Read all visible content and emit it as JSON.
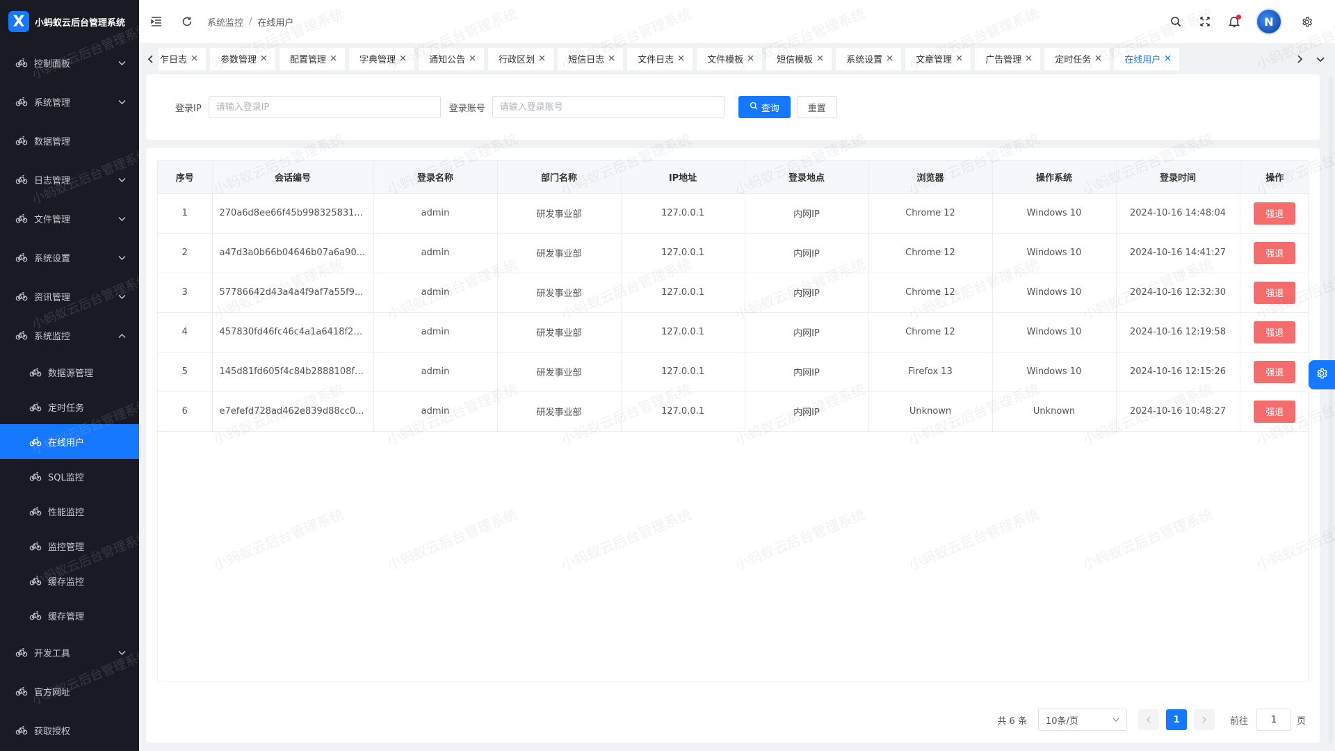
{
  "app": {
    "title": "小蚂蚁云后台管理系统",
    "logo_glyph": "X"
  },
  "sidebar": {
    "items": [
      {
        "label": "控制面板",
        "icon": "bicycle-icon",
        "expandable": true,
        "expanded": false
      },
      {
        "label": "系统管理",
        "icon": "bicycle-icon",
        "expandable": true,
        "expanded": false
      },
      {
        "label": "数据管理",
        "icon": "bicycle-icon",
        "expandable": false
      },
      {
        "label": "日志管理",
        "icon": "bicycle-icon",
        "expandable": true,
        "expanded": false
      },
      {
        "label": "文件管理",
        "icon": "bicycle-icon",
        "expandable": true,
        "expanded": false
      },
      {
        "label": "系统设置",
        "icon": "bicycle-icon",
        "expandable": true,
        "expanded": false
      },
      {
        "label": "资讯管理",
        "icon": "bicycle-icon",
        "expandable": true,
        "expanded": false
      },
      {
        "label": "系统监控",
        "icon": "bicycle-icon",
        "expandable": true,
        "expanded": true
      }
    ],
    "sub_items": [
      {
        "label": "数据源管理",
        "active": false
      },
      {
        "label": "定时任务",
        "active": false
      },
      {
        "label": "在线用户",
        "active": true
      },
      {
        "label": "SQL监控",
        "active": false
      },
      {
        "label": "性能监控",
        "active": false
      },
      {
        "label": "监控管理",
        "active": false
      },
      {
        "label": "缓存监控",
        "active": false
      },
      {
        "label": "缓存管理",
        "active": false
      }
    ],
    "bottom_items": [
      {
        "label": "开发工具",
        "icon": "bicycle-icon",
        "expandable": true
      },
      {
        "label": "官方网址",
        "icon": "bicycle-icon",
        "expandable": false
      },
      {
        "label": "获取授权",
        "icon": "bicycle-icon",
        "expandable": false
      }
    ]
  },
  "header": {
    "breadcrumb": [
      "系统监控",
      "在线用户"
    ],
    "separator": "/",
    "avatar_initial": "N"
  },
  "tabs": [
    {
      "label": "操作日志",
      "display": "乍日志",
      "active": false
    },
    {
      "label": "参数管理",
      "active": false
    },
    {
      "label": "配置管理",
      "active": false
    },
    {
      "label": "字典管理",
      "active": false
    },
    {
      "label": "通知公告",
      "active": false
    },
    {
      "label": "行政区划",
      "active": false
    },
    {
      "label": "短信日志",
      "active": false
    },
    {
      "label": "文件日志",
      "active": false
    },
    {
      "label": "文件模板",
      "active": false
    },
    {
      "label": "短信模板",
      "active": false
    },
    {
      "label": "系统设置",
      "active": false
    },
    {
      "label": "文章管理",
      "active": false
    },
    {
      "label": "广告管理",
      "active": false
    },
    {
      "label": "定时任务",
      "active": false
    },
    {
      "label": "在线用户",
      "active": true
    }
  ],
  "search": {
    "ip_label": "登录IP",
    "ip_placeholder": "请输入登录IP",
    "ip_value": "",
    "account_label": "登录账号",
    "account_placeholder": "请输入登录账号",
    "account_value": "",
    "query_label": "查询",
    "reset_label": "重置"
  },
  "table": {
    "columns": [
      "序号",
      "会话编号",
      "登录名称",
      "部门名称",
      "IP地址",
      "登录地点",
      "浏览器",
      "操作系统",
      "登录时间",
      "操作"
    ],
    "rows": [
      {
        "no": "1",
        "session": "270a6d8ee66f45b998325831...",
        "user": "admin",
        "dept": "研发事业部",
        "ip": "127.0.0.1",
        "location": "内网IP",
        "browser": "Chrome 12",
        "os": "Windows 10",
        "time": "2024-10-16 14:48:04",
        "action": "强退"
      },
      {
        "no": "2",
        "session": "a47d3a0b66b04646b07a6a90...",
        "user": "admin",
        "dept": "研发事业部",
        "ip": "127.0.0.1",
        "location": "内网IP",
        "browser": "Chrome 12",
        "os": "Windows 10",
        "time": "2024-10-16 14:41:27",
        "action": "强退"
      },
      {
        "no": "3",
        "session": "57786642d43a4a4f9af7a55f9...",
        "user": "admin",
        "dept": "研发事业部",
        "ip": "127.0.0.1",
        "location": "内网IP",
        "browser": "Chrome 12",
        "os": "Windows 10",
        "time": "2024-10-16 12:32:30",
        "action": "强退"
      },
      {
        "no": "4",
        "session": "457830fd46fc46c4a1a6418f2d...",
        "user": "admin",
        "dept": "研发事业部",
        "ip": "127.0.0.1",
        "location": "内网IP",
        "browser": "Chrome 12",
        "os": "Windows 10",
        "time": "2024-10-16 12:19:58",
        "action": "强退"
      },
      {
        "no": "5",
        "session": "145d81fd605f4c84b2888108fb...",
        "user": "admin",
        "dept": "研发事业部",
        "ip": "127.0.0.1",
        "location": "内网IP",
        "browser": "Firefox 13",
        "os": "Windows 10",
        "time": "2024-10-16 12:15:26",
        "action": "强退"
      },
      {
        "no": "6",
        "session": "e7efefd728ad462e839d88cc0...",
        "user": "admin",
        "dept": "研发事业部",
        "ip": "127.0.0.1",
        "location": "内网IP",
        "browser": "Unknown",
        "os": "Unknown",
        "time": "2024-10-16 10:48:27",
        "action": "强退"
      }
    ]
  },
  "pagination": {
    "total_text": "共 6 条",
    "page_size": "10条/页",
    "current_page": "1",
    "goto_label": "前往",
    "goto_value": "1",
    "page_unit": "页"
  },
  "watermark": {
    "text": "小蚂蚁云后台管理系统"
  },
  "colors": {
    "primary": "#1677ff",
    "sidebar_bg": "#191a23",
    "danger": "#f56c6c"
  }
}
